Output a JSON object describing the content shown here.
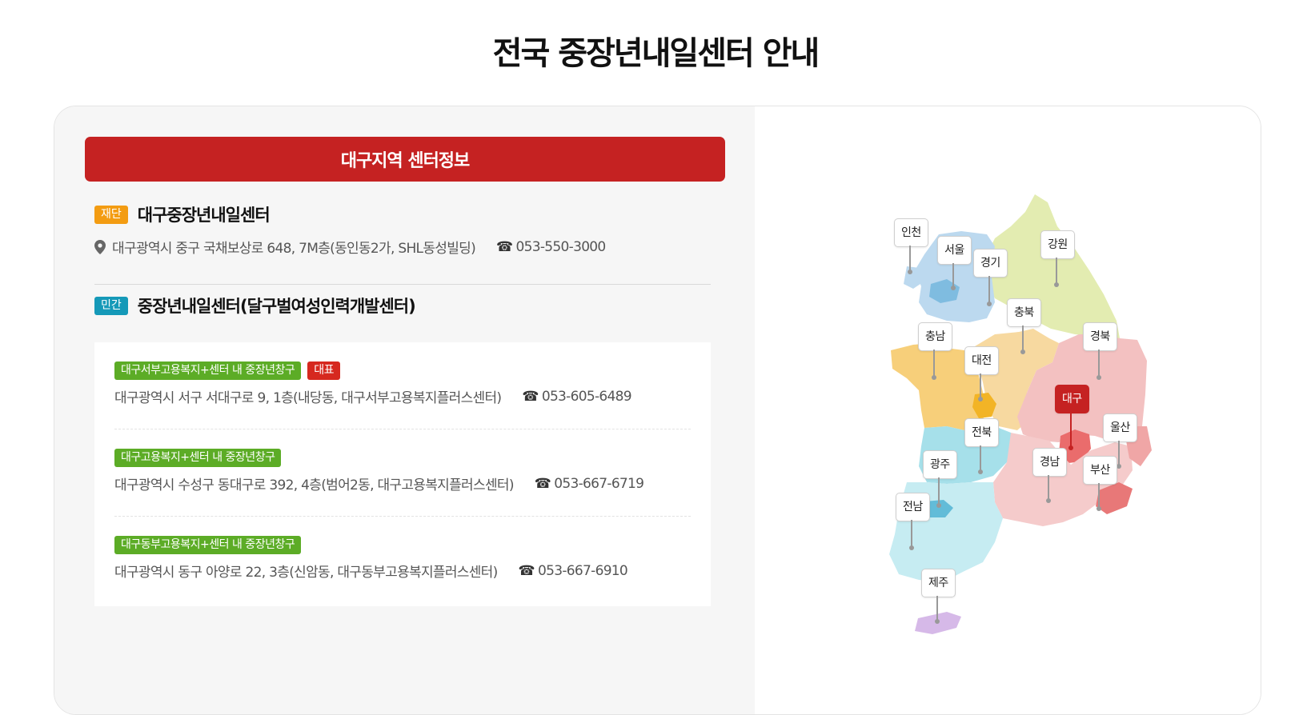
{
  "page": {
    "title": "전국 중장년내일센터 안내"
  },
  "region_panel": {
    "header": "대구지역 센터정보",
    "foundation": {
      "badge": "재단",
      "name": "대구중장년내일센터",
      "address": "대구광역시 중구 국채보상로 648, 7M층(동인동2가, SHL동성빌딩)",
      "phone": "053-550-3000"
    },
    "private": {
      "badge": "민간",
      "name": "중장년내일센터(달구벌여성인력개발센터)",
      "branches": [
        {
          "tag": "대구서부고용복지+센터 내 중장년창구",
          "extra_tag": "대표",
          "address": "대구광역시 서구 서대구로 9, 1층(내당동, 대구서부고용복지플러스센터)",
          "phone": "053-605-6489"
        },
        {
          "tag": "대구고용복지+센터 내 중장년창구",
          "address": "대구광역시 수성구 동대구로 392, 4층(범어2동, 대구고용복지플러스센터)",
          "phone": "053-667-6719"
        },
        {
          "tag": "대구동부고용복지+센터 내 중장년창구",
          "address": "대구광역시 동구 아양로 22, 3층(신암동, 대구동부고용복지플러스센터)",
          "phone": "053-667-6910"
        }
      ]
    },
    "phone_icon": "telephone-icon",
    "pin_icon": "map-pin-icon"
  },
  "map": {
    "selected": "대구",
    "regions": [
      "인천",
      "서울",
      "경기",
      "강원",
      "충북",
      "충남",
      "대전",
      "경북",
      "대구",
      "전북",
      "울산",
      "광주",
      "경남",
      "부산",
      "전남",
      "제주"
    ]
  },
  "colors": {
    "brand_red": "#c52222",
    "foundation_badge": "#f39c12",
    "private_badge": "#1599b8",
    "branch_tag": "#5cac26"
  }
}
